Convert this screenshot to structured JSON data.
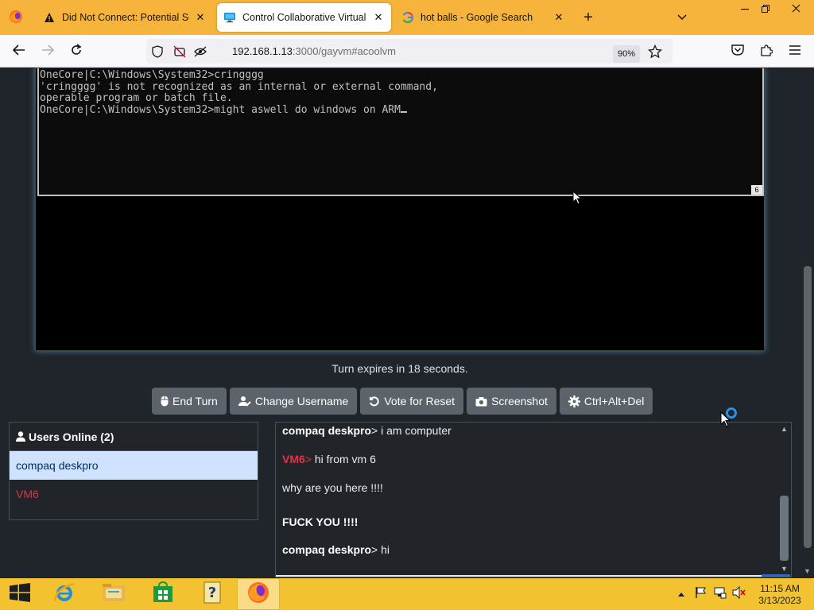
{
  "browser": {
    "tabs": [
      {
        "title": "Did Not Connect: Potential Secu",
        "icon": "warning-icon",
        "active": false
      },
      {
        "title": "Control Collaborative Virtual M",
        "icon": "monitor-icon",
        "active": true
      },
      {
        "title": "hot balls - Google Search",
        "icon": "google-icon",
        "active": false
      }
    ],
    "url_host": "192.168.1.13",
    "url_rest": ":3000/gayvm#acoolvm",
    "zoom": "90%"
  },
  "vm": {
    "console_lines": [
      "OneCore|C:\\Windows\\System32>cringggg",
      "'cringggg' is not recognized as an internal or external command,",
      "operable program or batch file.",
      "",
      "OneCore|C:\\Windows\\System32>might aswell do windows on ARM"
    ],
    "corner_label": "6"
  },
  "turn_text": "Turn expires in 18 seconds.",
  "buttons": {
    "end_turn": "End Turn",
    "change_username": "Change Username",
    "vote_reset": "Vote for Reset",
    "screenshot": "Screenshot",
    "ctrl_alt_del": "Ctrl+Alt+Del"
  },
  "users": {
    "header": "Users Online (2)",
    "list": [
      "compaq deskpro",
      "VM6"
    ]
  },
  "chat": [
    {
      "user": "compaq deskpro",
      "sep": "> ",
      "text": "i am computer"
    },
    {
      "user": "VM6",
      "sep": "> ",
      "text": "hi from vm 6"
    },
    {
      "text": "why are you here !!!!"
    },
    {
      "text": "FUCK YOU !!!!"
    },
    {
      "user": "compaq deskpro",
      "sep": "> ",
      "text": "hi"
    }
  ],
  "clock": {
    "time": "11:15 AM",
    "date": "3/13/2023"
  },
  "colors": {
    "accent": "#f7b43c",
    "taskbar": "#f2c230",
    "danger": "#dc3545"
  }
}
